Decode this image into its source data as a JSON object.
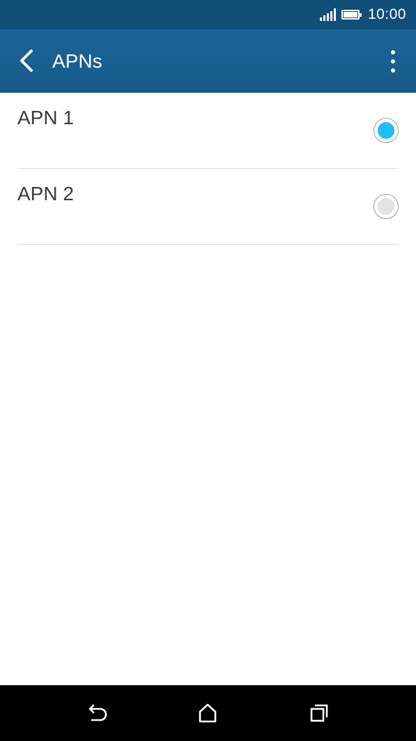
{
  "status_bar": {
    "time": "10:00",
    "signal_icon": "signal-icon",
    "battery_icon": "battery-icon"
  },
  "app_bar": {
    "title": "APNs",
    "back_icon": "chevron-left-icon",
    "menu_icon": "more-vert-icon"
  },
  "apn_list": {
    "items": [
      {
        "label": "APN 1",
        "selected": true
      },
      {
        "label": "APN 2",
        "selected": false
      }
    ]
  },
  "nav_bar": {
    "back_icon": "back-icon",
    "home_icon": "home-icon",
    "recents_icon": "recents-icon"
  },
  "colors": {
    "status_bar": "#0f4f78",
    "app_bar": "#1b6396",
    "radio_selected": "#1fbef5",
    "radio_unselected": "#e3e3e3",
    "nav_bar": "#000000"
  }
}
